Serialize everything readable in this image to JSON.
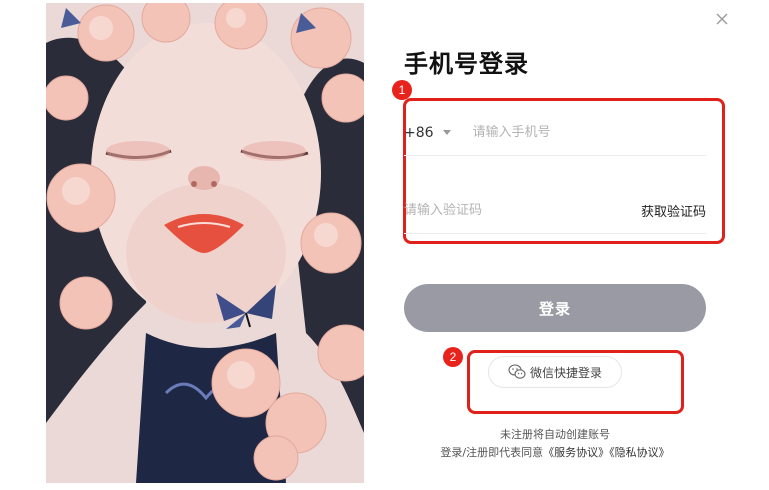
{
  "dialog": {
    "title": "手机号登录",
    "close_icon": "close-icon",
    "illustration_icon": "portrait-illustration"
  },
  "annotations": {
    "badge_1": "1",
    "badge_2": "2",
    "highlight_color": "#e0201a"
  },
  "phone": {
    "country_code": "+86",
    "placeholder": "请输入手机号",
    "value": ""
  },
  "code": {
    "placeholder": "请输入验证码",
    "value": "",
    "get_code_label": "获取验证码"
  },
  "login_button": {
    "label": "登录",
    "color": "#999aa3"
  },
  "wechat": {
    "label": "微信快捷登录",
    "icon": "wechat-icon"
  },
  "footer": {
    "line1": "未注册将自动创建账号",
    "agree_prefix": "登录/注册即代表同意",
    "service_link": "《服务协议》",
    "privacy_link": "《隐私协议》"
  }
}
